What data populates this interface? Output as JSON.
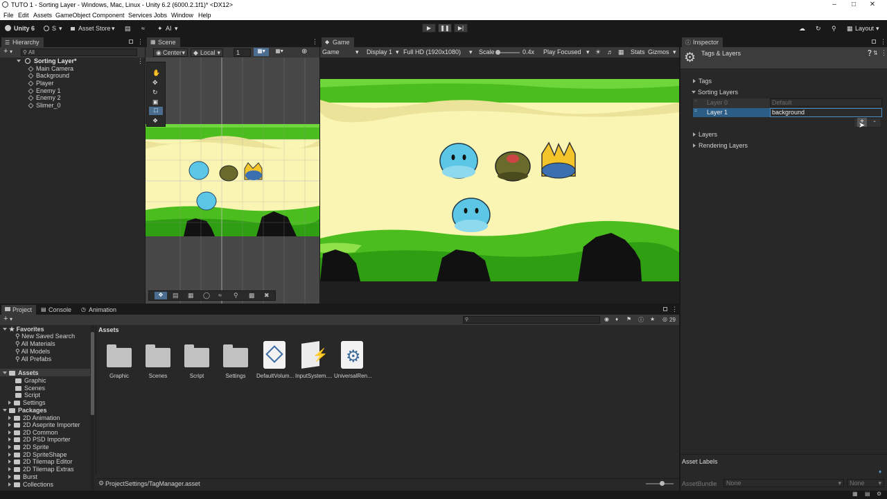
{
  "window": {
    "title": "TUTO 1 - Sorting Layer - Windows, Mac, Linux - Unity 6.2 (6000.2.1f1)* <DX12>"
  },
  "menu": [
    "File",
    "Edit",
    "Assets",
    "GameObject",
    "Component",
    "Services",
    "Jobs",
    "Window",
    "Help"
  ],
  "toolbar": {
    "unity_label": "Unity 6",
    "account_label": "S",
    "asset_store_label": "Asset Store",
    "ai_label": "AI",
    "layout_label": "Layout"
  },
  "hierarchy": {
    "tab_label": "Hierarchy",
    "search_placeholder": "All",
    "scene_name": "Sorting Layer*",
    "objects": [
      "Main Camera",
      "Background",
      "Player",
      "Enemy 1",
      "Enemy 2",
      "Slimer_0"
    ]
  },
  "scene": {
    "tab_label": "Scene",
    "pivot_label": "Center",
    "space_label": "Local",
    "grid_value": "1"
  },
  "game": {
    "tab_label": "Game",
    "view_label": "Game",
    "display_label": "Display 1",
    "resolution_label": "Full HD (1920x1080)",
    "scale_label": "Scale",
    "scale_value": "0.4x",
    "play_mode_label": "Play Focused",
    "stats_label": "Stats",
    "gizmos_label": "Gizmos"
  },
  "inspector": {
    "tab_label": "Inspector",
    "header_title": "Tags & Layers",
    "sections": {
      "tags": "Tags",
      "sorting_layers": "Sorting Layers",
      "layers": "Layers",
      "rendering_layers": "Rendering Layers"
    },
    "sorting_layers": [
      {
        "label": "Layer 0",
        "value": "Default"
      },
      {
        "label": "Layer 1",
        "value": "background"
      }
    ],
    "add_button": "+",
    "remove_button": "-",
    "asset_labels": "Asset Labels",
    "asset_bundle_label": "AssetBundle",
    "asset_bundle_value": "None",
    "asset_bundle_variant": "None"
  },
  "project": {
    "tabs": [
      "Project",
      "Console",
      "Animation"
    ],
    "badge_count": "29",
    "favorites_label": "Favorites",
    "favorites": [
      "New Saved Search",
      "All Materials",
      "All Models",
      "All Prefabs"
    ],
    "assets_label": "Assets",
    "asset_folders": [
      "Graphic",
      "Scenes",
      "Script",
      "Settings"
    ],
    "packages_label": "Packages",
    "packages": [
      "2D Animation",
      "2D Aseprite Importer",
      "2D Common",
      "2D PSD Importer",
      "2D Sprite",
      "2D SpriteShape",
      "2D Tilemap Editor",
      "2D Tilemap Extras",
      "Burst",
      "Collections"
    ],
    "breadcrumb": "Assets",
    "grid_items": [
      "Graphic",
      "Scenes",
      "Script",
      "Settings",
      "DefaultVolum...",
      "InputSystem....",
      "UniversalRen..."
    ],
    "status_path": "ProjectSettings/TagManager.asset"
  },
  "colors": {
    "selection": "#2c5d87",
    "grass": "#4cbd1e",
    "sand": "#faf5b3",
    "slime": "#5bc6e6"
  }
}
